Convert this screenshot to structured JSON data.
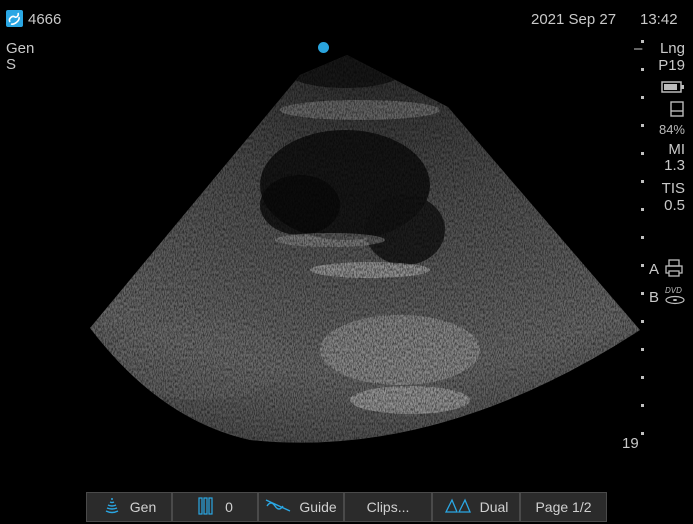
{
  "header": {
    "patient_id": "4666",
    "preset": "Gen",
    "preset_sub": "S",
    "date": "2021 Sep 27",
    "time": "13:42"
  },
  "side_panel": {
    "transducer": "Lng",
    "probe": "P19",
    "battery_pct": "84%",
    "mi_label": "MI",
    "mi_value": "1.3",
    "tis_label": "TIS",
    "tis_value": "0.5",
    "print_a_label": "A",
    "print_b_label": "B"
  },
  "depth": {
    "value": "19"
  },
  "bottom_bar": {
    "gen_label": "Gen",
    "gain_value": "0",
    "guide_label": "Guide",
    "clips_label": "Clips...",
    "dual_label": "Dual",
    "page_label": "Page 1/2"
  },
  "colors": {
    "accent": "#2aa7e4",
    "background": "#000000"
  }
}
